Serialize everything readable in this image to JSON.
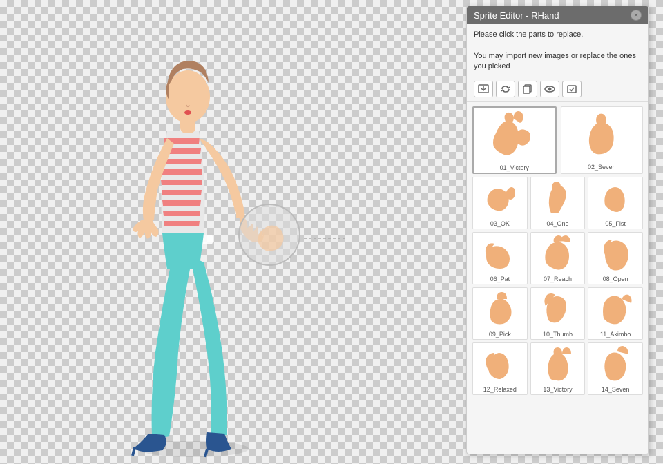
{
  "panel": {
    "title": "Sprite Editor - RHand",
    "instructions_line1": "Please click the parts to replace.",
    "instructions_line2": "You may import new images or replace the ones you picked",
    "close_label": "×",
    "toolbar": {
      "btn1": "↩",
      "btn2": "↪",
      "btn3": "⊡",
      "btn4": "👁",
      "btn5": "✓"
    },
    "sprites": [
      {
        "id": "01",
        "label": "01_Victory",
        "featured": true
      },
      {
        "id": "02",
        "label": "02_Seven",
        "featured": true
      },
      {
        "id": "03",
        "label": "03_OK"
      },
      {
        "id": "04",
        "label": "04_One"
      },
      {
        "id": "05",
        "label": "05_Fist"
      },
      {
        "id": "06",
        "label": "06_Pat"
      },
      {
        "id": "07",
        "label": "07_Reach"
      },
      {
        "id": "08",
        "label": "08_Open"
      },
      {
        "id": "09",
        "label": "09_Pick"
      },
      {
        "id": "10",
        "label": "10_Thumb"
      },
      {
        "id": "11",
        "label": "11_Akimbo"
      },
      {
        "id": "12",
        "label": "12_Relaxed"
      },
      {
        "id": "13",
        "label": "13_Victory"
      },
      {
        "id": "14",
        "label": "14_Seven"
      }
    ]
  }
}
